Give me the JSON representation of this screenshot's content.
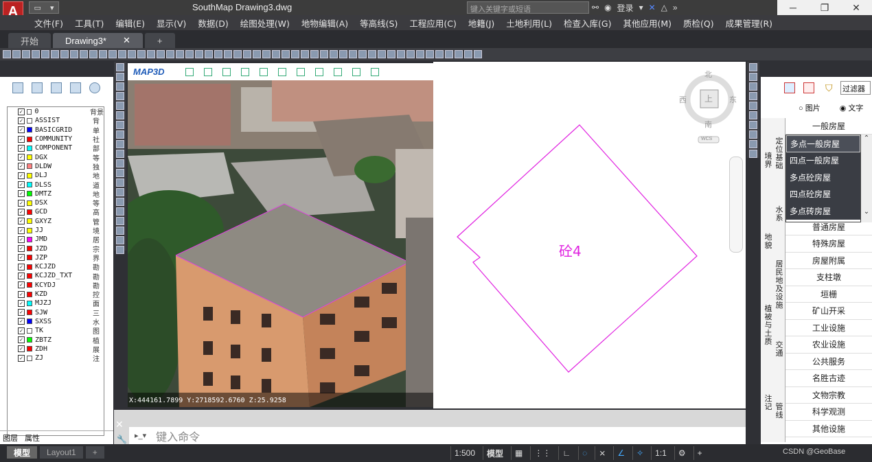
{
  "app": {
    "logo": "A",
    "title": "SouthMap    Drawing3.dwg",
    "search_placeholder": "键入关键字或短语",
    "login": "登录"
  },
  "menu": [
    "文件(F)",
    "工具(T)",
    "编辑(E)",
    "显示(V)",
    "数据(D)",
    "绘图处理(W)",
    "地物编辑(A)",
    "等高线(S)",
    "工程应用(C)",
    "地籍(J)",
    "土地利用(L)",
    "检查入库(G)",
    "其他应用(M)",
    "质检(Q)",
    "成果管理(R)"
  ],
  "tabs": [
    "开始",
    "Drawing3*"
  ],
  "layers": [
    {
      "name": "0",
      "desc": "背景",
      "color": "#ffffff"
    },
    {
      "name": "ASSIST",
      "desc": "背",
      "color": "#ffffff"
    },
    {
      "name": "BASICGRID",
      "desc": "单",
      "color": "#0000ff"
    },
    {
      "name": "COMMUNITY",
      "desc": "社",
      "color": "#ff0000"
    },
    {
      "name": "COMPONENT",
      "desc": "部",
      "color": "#00ffff"
    },
    {
      "name": "DGX",
      "desc": "等",
      "color": "#ffff00"
    },
    {
      "name": "DLDW",
      "desc": "独",
      "color": "#ff8080"
    },
    {
      "name": "DLJ",
      "desc": "地",
      "color": "#ffff00"
    },
    {
      "name": "DLSS",
      "desc": "道",
      "color": "#00ffff"
    },
    {
      "name": "DMTZ",
      "desc": "地",
      "color": "#00ff00"
    },
    {
      "name": "DSX",
      "desc": "等",
      "color": "#ffff00"
    },
    {
      "name": "GCD",
      "desc": "高",
      "color": "#ff0000"
    },
    {
      "name": "GXYZ",
      "desc": "管",
      "color": "#ffff00"
    },
    {
      "name": "JJ",
      "desc": "境",
      "color": "#ffff00"
    },
    {
      "name": "JMD",
      "desc": "居",
      "color": "#ff00ff"
    },
    {
      "name": "JZD",
      "desc": "宗",
      "color": "#ff0000"
    },
    {
      "name": "JZP",
      "desc": "界",
      "color": "#ff0000"
    },
    {
      "name": "KCJZD",
      "desc": "勘",
      "color": "#ff0000"
    },
    {
      "name": "KCJZD_TXT",
      "desc": "勘",
      "color": "#ff0000"
    },
    {
      "name": "KCYDJ",
      "desc": "勘",
      "color": "#ff0000"
    },
    {
      "name": "KZD",
      "desc": "控",
      "color": "#ff0000"
    },
    {
      "name": "MJZJ",
      "desc": "面",
      "color": "#00ffff"
    },
    {
      "name": "SJW",
      "desc": "三",
      "color": "#ff0000"
    },
    {
      "name": "SXSS",
      "desc": "水",
      "color": "#0000ff"
    },
    {
      "name": "TK",
      "desc": "图",
      "color": "#ffffff"
    },
    {
      "name": "ZBTZ",
      "desc": "植",
      "color": "#00ff00"
    },
    {
      "name": "ZDH",
      "desc": "展",
      "color": "#ff0000"
    },
    {
      "name": "ZJ",
      "desc": "注",
      "color": "#ffffff"
    }
  ],
  "left_tabs": [
    "图层",
    "属性"
  ],
  "map3d": {
    "label": "MAP3D",
    "coords": "X:444161.7899  Y:2718592.6760  Z:25.9258"
  },
  "cad": {
    "label": "砼4",
    "viewcube": {
      "n": "北",
      "s": "南",
      "e": "东",
      "w": "西",
      "face": "上",
      "wcs": "WCS"
    }
  },
  "right": {
    "filter": "过滤器",
    "radio_image": "图片",
    "radio_text": "文字",
    "categories": [
      "境界",
      "定位基础",
      "水系",
      "地貌",
      "居民地及设施",
      "植被与土质",
      "交通",
      "注记",
      "管线"
    ],
    "items": [
      "一般房屋",
      "多点一般房屋",
      "四点一般房屋",
      "多点砼房屋",
      "四点砼房屋",
      "多点砖房屋",
      "普通房屋",
      "特殊房屋",
      "房屋附属",
      "支柱墩",
      "垣栅",
      "矿山开采",
      "工业设施",
      "农业设施",
      "公共服务",
      "名胜古迹",
      "文物宗教",
      "科学观测",
      "其他设施"
    ],
    "dropdown": [
      "多点一般房屋",
      "四点一般房屋",
      "多点砼房屋",
      "四点砼房屋",
      "多点砖房屋"
    ]
  },
  "cmd": {
    "placeholder": "键入命令"
  },
  "status": {
    "tabs": [
      "模型",
      "Layout1"
    ],
    "scale": "1:500",
    "model": "模型",
    "ratio": "1:1",
    "watermark": "CSDN @GeoBase"
  }
}
